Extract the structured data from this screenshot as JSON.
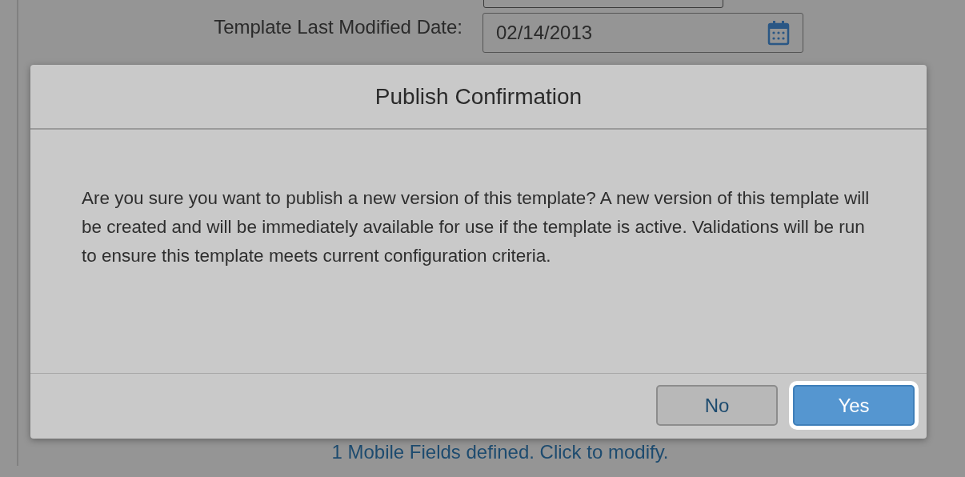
{
  "page": {
    "date_label": "Template Last Modified Date:",
    "date_value": "02/14/2013",
    "link": "1 Mobile Fields defined. Click to modify."
  },
  "dialog": {
    "title": "Publish Confirmation",
    "message": "Are you sure you want to publish a new version of this template? A new version of this template will be created and will be immediately available for use if the template is active. Validations will be run to ensure this template meets current configuration criteria.",
    "buttons": [
      {
        "label": "No",
        "kind": "secondary",
        "focused": false
      },
      {
        "label": "Yes",
        "kind": "primary",
        "focused": true
      }
    ]
  }
}
